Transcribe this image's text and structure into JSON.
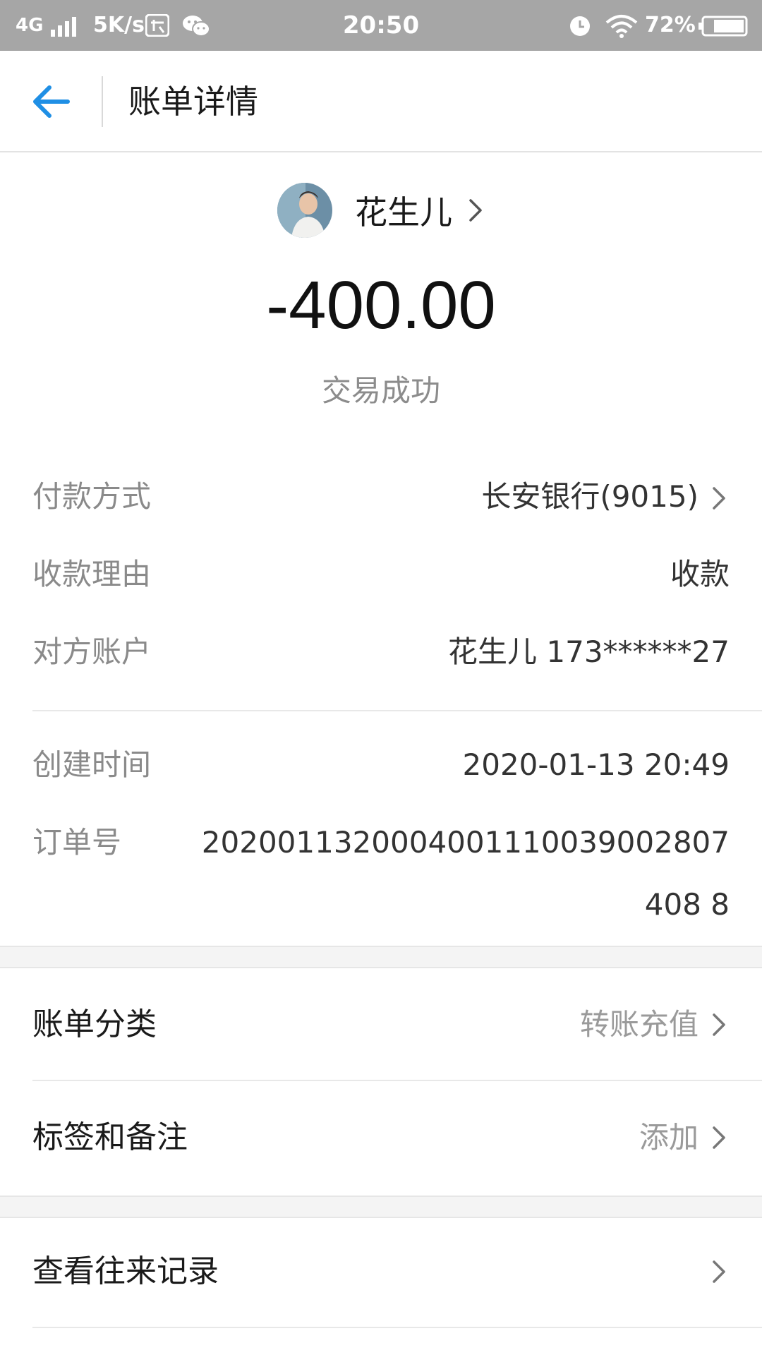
{
  "status_bar": {
    "network": "4G",
    "speed": "5K/s",
    "time": "20:50",
    "battery": "72%"
  },
  "header": {
    "title": "账单详情"
  },
  "summary": {
    "payee_name": "花生儿",
    "amount": "-400.00",
    "status": "交易成功"
  },
  "details": {
    "payment_method": {
      "label": "付款方式",
      "value": "长安银行(9015)"
    },
    "reason": {
      "label": "收款理由",
      "value": "收款"
    },
    "counterparty": {
      "label": "对方账户",
      "value": "花生儿 173******27"
    },
    "created": {
      "label": "创建时间",
      "value": "2020-01-13 20:49"
    },
    "order_no": {
      "label": "订单号",
      "value": "2020011320004001110039002807408 8"
    }
  },
  "menu": {
    "category": {
      "label": "账单分类",
      "value": "转账充值"
    },
    "tags": {
      "label": "标签和备注",
      "value": "添加"
    },
    "history": {
      "label": "查看往来记录"
    }
  },
  "colors": {
    "accent": "#1f8fe5",
    "status_bar": "#a6a6a6",
    "muted_text": "#8a8a8a",
    "section_bg": "#f4f4f4"
  },
  "icons": [
    "back-arrow-icon",
    "chevron-right-icon",
    "signal-icon",
    "wifi-icon",
    "alarm-icon",
    "battery-icon",
    "wechat-icon"
  ]
}
